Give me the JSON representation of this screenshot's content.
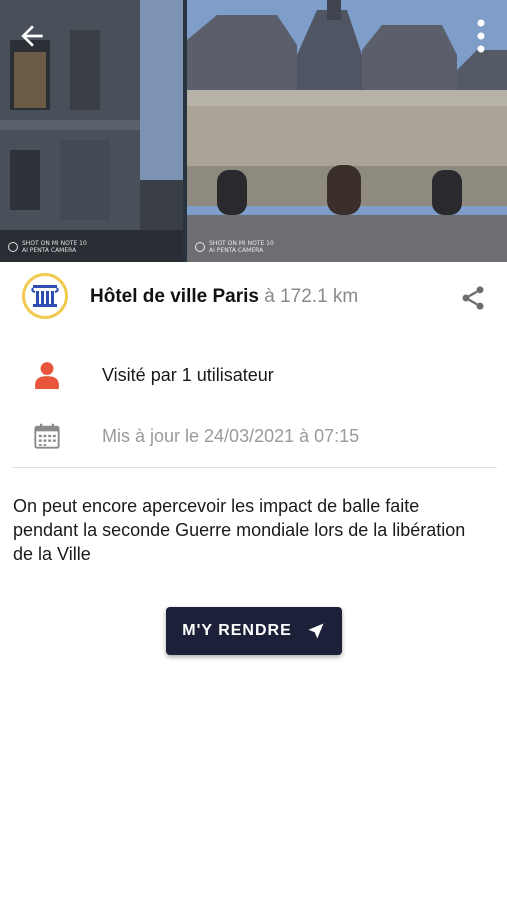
{
  "gallery": {
    "photos": [
      {
        "watermark": "SHOT ON MI NOTE 10\nAI PENTA CAMERA"
      },
      {
        "watermark": "SHOT ON MI NOTE 10\nAI PENTA CAMERA"
      }
    ]
  },
  "toolbar": {
    "back_icon": "arrow-left-icon",
    "more_icon": "more-vertical-icon"
  },
  "place": {
    "name": "Hôtel de ville Paris",
    "distance": " à 172.1 km",
    "logo_icon": "monument-column-icon",
    "share_icon": "share-icon"
  },
  "info": {
    "visits": "Visité par 1 utilisateur",
    "visits_icon": "person-icon",
    "updated": "Mis à jour le 24/03/2021 à 07:15",
    "updated_icon": "calendar-icon"
  },
  "description": "On peut encore apercevoir les impact de balle faite pendant la seconde Guerre mondiale lors de la libération de la Ville",
  "action": {
    "label": "M'Y RENDRE",
    "icon": "navigation-arrow-icon"
  },
  "colors": {
    "accent_red": "#e8553a",
    "button_bg": "#1c2039",
    "logo_border": "#f1c94e",
    "logo_blue": "#2d4db0"
  }
}
